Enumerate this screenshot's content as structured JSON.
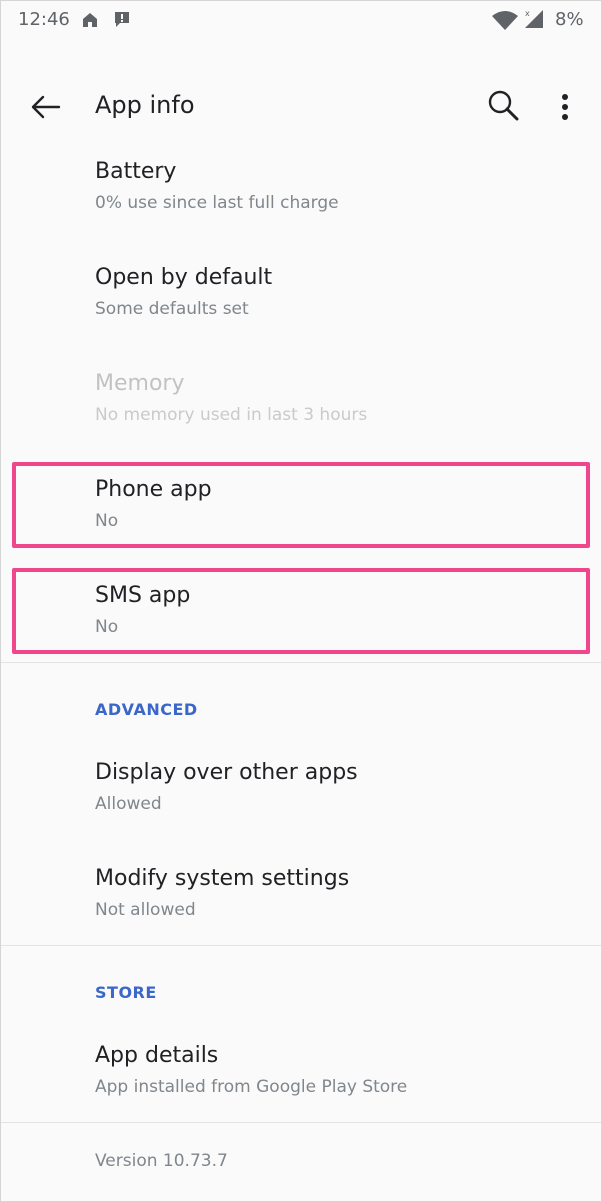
{
  "status_bar": {
    "time": "12:46",
    "battery": "8%",
    "icons": [
      "home-icon",
      "alert-icon",
      "wifi-icon",
      "signal-icon"
    ]
  },
  "toolbar": {
    "title": "App info",
    "icons": [
      "back-arrow-icon",
      "search-icon",
      "more-vert-icon"
    ]
  },
  "items": [
    {
      "title": "Battery",
      "subtitle": "0% use since last full charge"
    },
    {
      "title": "Open by default",
      "subtitle": "Some defaults set"
    },
    {
      "title": "Memory",
      "subtitle": "No memory used in last 3 hours"
    },
    {
      "title": "Phone app",
      "subtitle": "No"
    },
    {
      "title": "SMS app",
      "subtitle": "No"
    }
  ],
  "advanced": {
    "header": "ADVANCED",
    "items": [
      {
        "title": "Display over other apps",
        "subtitle": "Allowed"
      },
      {
        "title": "Modify system settings",
        "subtitle": "Not allowed"
      }
    ]
  },
  "store": {
    "header": "STORE",
    "items": [
      {
        "title": "App details",
        "subtitle": "App installed from Google Play Store"
      }
    ]
  },
  "version": "Version 10.73.7",
  "colors": {
    "accent": "#3b67c9",
    "highlight": "#f0468c",
    "background": "#fafafa"
  }
}
